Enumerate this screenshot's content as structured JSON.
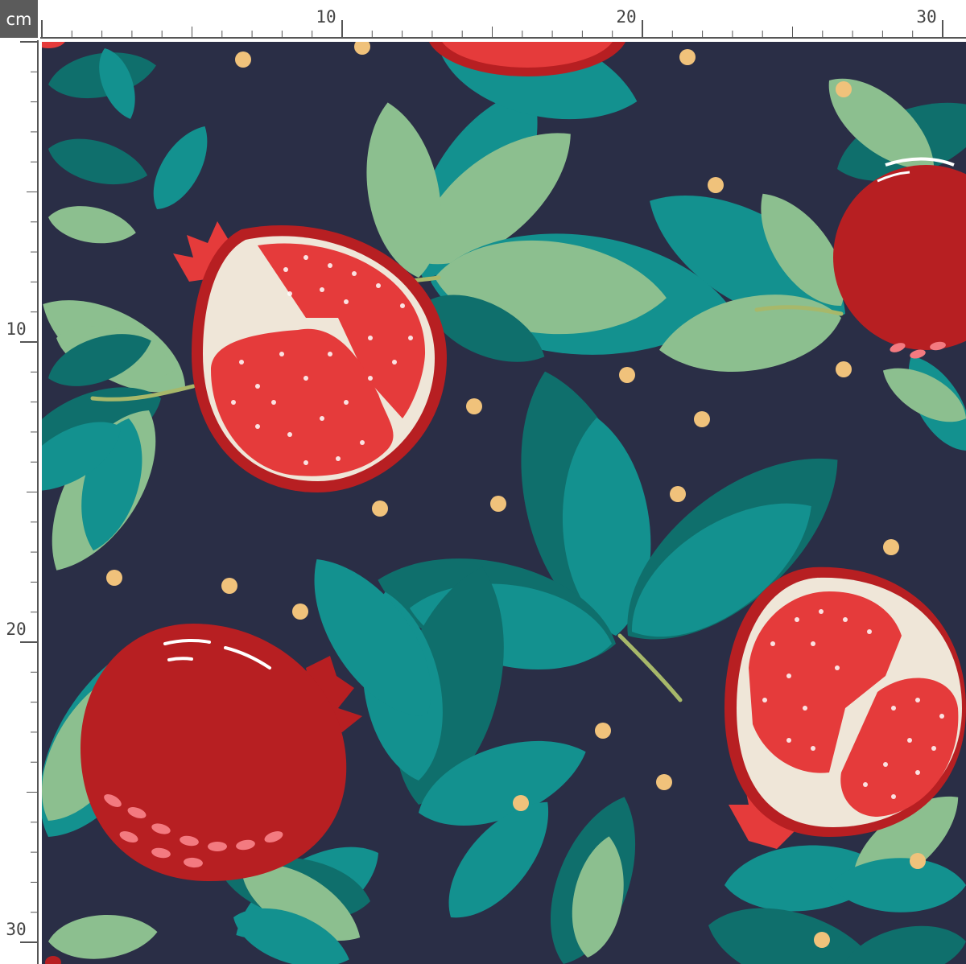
{
  "ruler": {
    "unit": "cm",
    "top_labels": [
      "10",
      "20",
      "30"
    ],
    "left_labels": [
      "10",
      "20",
      "30"
    ]
  },
  "colors": {
    "background": "#2a2e46",
    "leaf_dark": "#0f6f6c",
    "leaf_teal": "#13918f",
    "leaf_light": "#8cbf8f",
    "fruit_red": "#b71f22",
    "seed_red": "#e53b3b",
    "pith": "#efe6d8",
    "dot": "#f0c27b",
    "ruler_unit_bg": "#5b5b5b"
  },
  "pattern": {
    "name": "pomegranate-pattern",
    "icons": [
      "pomegranate-half-icon",
      "pomegranate-whole-icon",
      "leaf-icon",
      "dot-icon"
    ]
  }
}
